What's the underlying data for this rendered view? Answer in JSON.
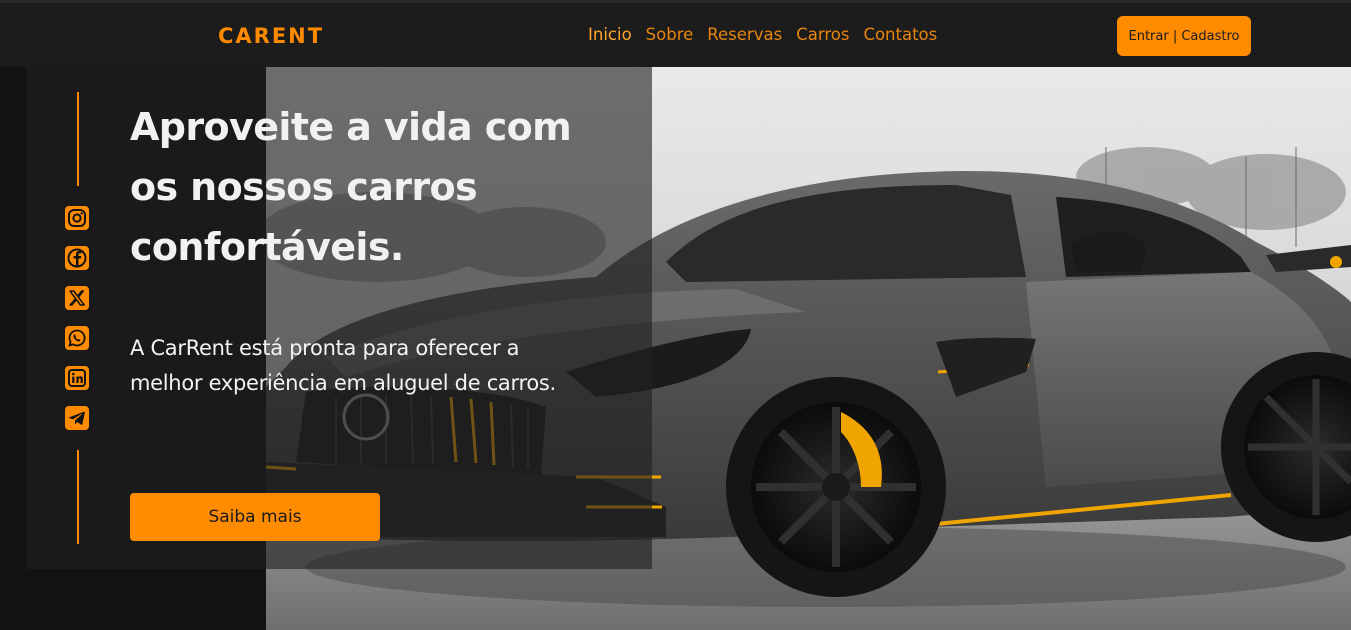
{
  "brand": {
    "logo": "CARENT",
    "accent": "#ff8c00"
  },
  "nav": {
    "items": [
      {
        "label": "Inicio",
        "active": true
      },
      {
        "label": "Sobre",
        "active": false
      },
      {
        "label": "Reservas",
        "active": false
      },
      {
        "label": "Carros",
        "active": false
      },
      {
        "label": "Contatos",
        "active": false
      }
    ],
    "login_label": "Entrar | Cadastro"
  },
  "hero": {
    "title": "Aproveite a vida com os nossos carros confortáveis.",
    "description": "A CarRent está pronta para oferecer a melhor experiência em aluguel de carros.",
    "cta_label": "Saiba mais"
  },
  "social": {
    "icons": [
      "instagram-icon",
      "facebook-icon",
      "x-icon",
      "whatsapp-icon",
      "linkedin-icon",
      "telegram-icon"
    ]
  },
  "colors": {
    "header_bg": "#1c1c1c",
    "page_bg": "#121212",
    "title": "#f1f1f1"
  }
}
